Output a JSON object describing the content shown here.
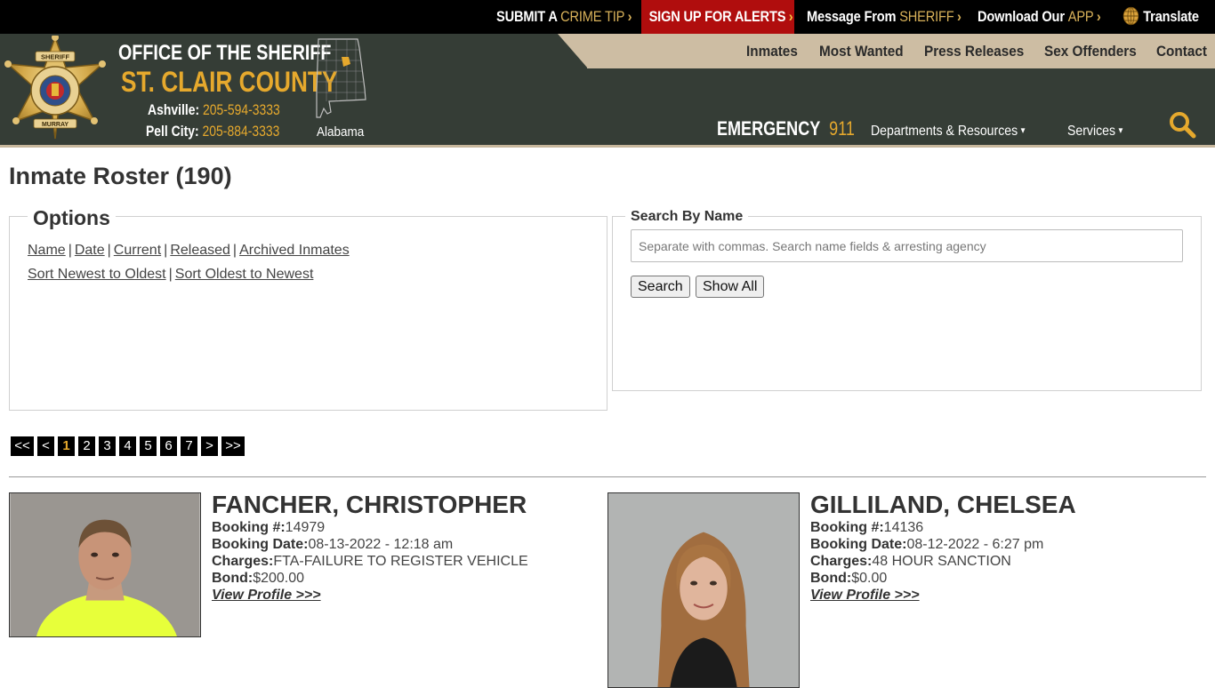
{
  "topbar": {
    "tip": {
      "pre": "SUBMIT A",
      "gold": "CRIME TIP",
      "chev": "›"
    },
    "alerts": {
      "text": "SIGN UP FOR ALERTS",
      "chev": "›"
    },
    "message": {
      "pre": "Message From",
      "gold": "SHERIFF",
      "chev": "›"
    },
    "download": {
      "pre": "Download Our",
      "gold": "APP",
      "chev": "›"
    },
    "translate": "Translate"
  },
  "nav": {
    "inmates": "Inmates",
    "most_wanted": "Most Wanted",
    "press_releases": "Press Releases",
    "sex_offenders": "Sex Offenders",
    "contact": "Contact"
  },
  "org": {
    "line1": "OFFICE OF THE SHERIFF",
    "line2": "ST. CLAIR COUNTY",
    "phones": [
      {
        "label": "Ashville:",
        "number": "205-594-3333"
      },
      {
        "label": "Pell City:",
        "number": "205-884-3333"
      }
    ],
    "state": "Alabama",
    "badge_text": {
      "top": "SHERIFF",
      "ring": "ST. CLAIR COUNTY",
      "ring2": "SHERIFF'S OFFICE",
      "bottom": "MURRAY"
    }
  },
  "emergency": {
    "label": "EMERGENCY",
    "number": "911"
  },
  "subnav": {
    "departments": "Departments & Resources",
    "services": "Services",
    "caret": "▾"
  },
  "page": {
    "title": "Inmate Roster (190)"
  },
  "options": {
    "legend": "Options",
    "row1": [
      "Name",
      "Date",
      "Current",
      "Released",
      "Archived Inmates"
    ],
    "row2": [
      "Sort Newest to Oldest",
      "Sort Oldest to Newest"
    ],
    "sep": "|"
  },
  "search": {
    "legend": "Search By Name",
    "placeholder": "Separate with commas. Search name fields & arresting agency",
    "search_btn": "Search",
    "showall_btn": "Show All"
  },
  "pager": {
    "items": [
      "<<",
      "<",
      "1",
      "2",
      "3",
      "4",
      "5",
      "6",
      "7",
      ">",
      ">>"
    ],
    "active": "1"
  },
  "inmates": [
    {
      "name": "FANCHER, CHRISTOPHER",
      "booking_label": "Booking #:",
      "booking": "14979",
      "date_label": "Booking Date:",
      "date": "08-13-2022 - 12:18 am",
      "charges_label": "Charges:",
      "charges": "FTA-FAILURE TO REGISTER VEHICLE",
      "bond_label": "Bond:",
      "bond": "$200.00",
      "profile": "View Profile >>>"
    },
    {
      "name": "GILLILAND, CHELSEA",
      "booking_label": "Booking #:",
      "booking": "14136",
      "date_label": "Booking Date:",
      "date": "08-12-2022 - 6:27 pm",
      "charges_label": "Charges:",
      "charges": "48 HOUR SANCTION",
      "bond_label": "Bond:",
      "bond": "$0.00",
      "profile": "View Profile >>>"
    }
  ],
  "colors": {
    "gold": "#e6a92d",
    "header_bg": "#353d36",
    "alert_red": "#b00d0d",
    "nav_tan": "#cdbda3"
  }
}
